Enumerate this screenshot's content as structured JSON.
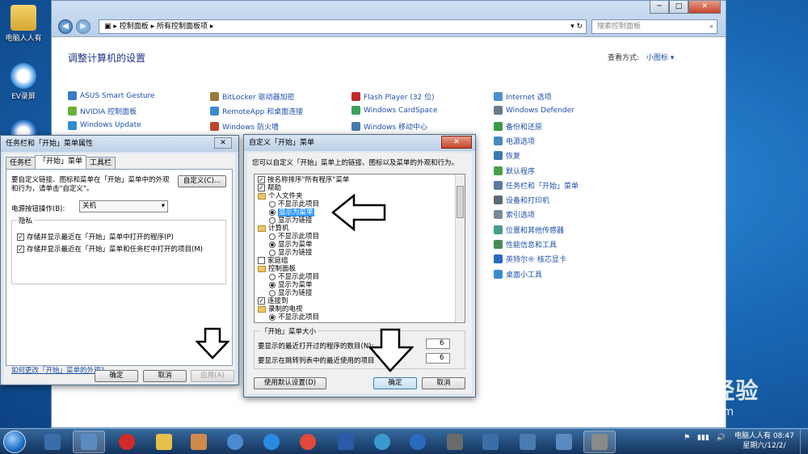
{
  "desktop": {
    "icons": [
      {
        "label": "电脑人人有",
        "icon": "user-folder-icon"
      },
      {
        "label": "EV录屏",
        "icon": "ev-recorder-icon"
      },
      {
        "label": "",
        "icon": "app-s-icon"
      }
    ]
  },
  "control_panel": {
    "breadcrumb": [
      "控制面板",
      "所有控制面板项"
    ],
    "search_placeholder": "搜索控制面板",
    "heading": "调整计算机的设置",
    "view_by_label": "查看方式:",
    "view_by_value": "小图标 ▾",
    "items": [
      {
        "label": "ASUS Smart Gesture",
        "color": "#3a78c8"
      },
      {
        "label": "NVIDIA 控制面板",
        "color": "#6bb13a"
      },
      {
        "label": "Windows Update",
        "color": "#2e8fd0"
      },
      {
        "label": "BitLocker 驱动器加密",
        "color": "#9a7a3a"
      },
      {
        "label": "RemoteApp 和桌面连接",
        "color": "#3a8ad0"
      },
      {
        "label": "Windows 防火墙",
        "color": "#c0452b"
      },
      {
        "label": "Flash Player (32 位)",
        "color": "#c02a2a"
      },
      {
        "label": "Windows CardSpace",
        "color": "#3aa05a"
      },
      {
        "label": "Windows 移动中心",
        "color": "#4a7ab0"
      },
      {
        "label": "Internet 选项",
        "color": "#4a90d0"
      },
      {
        "label": "Windows Defender",
        "color": "#6a7a8a"
      },
      {
        "label": "备份和还原",
        "color": "#3a9a4a"
      },
      {
        "label": "电源选项",
        "color": "#4a8ac0"
      },
      {
        "label": "恢复",
        "color": "#3a7ab0"
      },
      {
        "label": "默认程序",
        "color": "#4aa04a"
      },
      {
        "label": "任务栏和「开始」菜单",
        "color": "#5a7aa0"
      },
      {
        "label": "设备和打印机",
        "color": "#5a6a7a"
      },
      {
        "label": "索引选项",
        "color": "#7a8a9a"
      },
      {
        "label": "位置和其他传感器",
        "color": "#4a9a8a"
      },
      {
        "label": "性能信息和工具",
        "color": "#4a8a5a"
      },
      {
        "label": "英特尔® 核芯显卡",
        "color": "#2a6ac0"
      },
      {
        "label": "桌面小工具",
        "color": "#3a8ad0"
      }
    ]
  },
  "taskbar_props": {
    "title": "任务栏和「开始」菜单属性",
    "tabs": [
      "任务栏",
      "「开始」菜单",
      "工具栏"
    ],
    "description": "要自定义链接、图标和菜单在「开始」菜单中的外观和行为，请单击\"自定义\"。",
    "customize_button": "自定义(C)...",
    "power_button_label": "电源按钮操作(B):",
    "power_button_value": "关机",
    "privacy_label": "隐私",
    "privacy_options": [
      "存储并显示最近在「开始」菜单中打开的程序(P)",
      "存储并显示最近在「开始」菜单和任务栏中打开的项目(M)"
    ],
    "help_link": "如何更改「开始」菜单的外观?",
    "buttons": {
      "ok": "确定",
      "cancel": "取消",
      "apply": "应用(A)"
    }
  },
  "customize_dialog": {
    "title": "自定义「开始」菜单",
    "description": "您可以自定义「开始」菜单上的链接、图标以及菜单的外观和行为。",
    "tree": [
      {
        "kind": "check",
        "checked": true,
        "label": "按名称排序\"所有程序\"菜单",
        "indent": 0
      },
      {
        "kind": "check",
        "checked": true,
        "label": "帮助",
        "indent": 0
      },
      {
        "kind": "folder",
        "label": "个人文件夹",
        "indent": 0
      },
      {
        "kind": "radio",
        "on": false,
        "label": "不显示此项目",
        "indent": 1
      },
      {
        "kind": "radio",
        "on": true,
        "label": "显示为菜单",
        "indent": 1,
        "selected": true
      },
      {
        "kind": "radio",
        "on": false,
        "label": "显示为链接",
        "indent": 1
      },
      {
        "kind": "folder",
        "label": "计算机",
        "indent": 0
      },
      {
        "kind": "radio",
        "on": false,
        "label": "不显示此项目",
        "indent": 1
      },
      {
        "kind": "radio",
        "on": true,
        "label": "显示为菜单",
        "indent": 1
      },
      {
        "kind": "radio",
        "on": false,
        "label": "显示为链接",
        "indent": 1
      },
      {
        "kind": "check",
        "checked": false,
        "label": "家庭组",
        "indent": 0
      },
      {
        "kind": "folder",
        "label": "控制面板",
        "indent": 0
      },
      {
        "kind": "radio",
        "on": false,
        "label": "不显示此项目",
        "indent": 1
      },
      {
        "kind": "radio",
        "on": true,
        "label": "显示为菜单",
        "indent": 1
      },
      {
        "kind": "radio",
        "on": false,
        "label": "显示为链接",
        "indent": 1
      },
      {
        "kind": "check",
        "checked": true,
        "label": "连接到",
        "indent": 0
      },
      {
        "kind": "folder",
        "label": "录制的电视",
        "indent": 0
      },
      {
        "kind": "radio",
        "on": true,
        "label": "不显示此项目",
        "indent": 1
      }
    ],
    "size_group_label": "「开始」菜单大小",
    "recent_programs_label": "要显示的最近打开过的程序的数目(N):",
    "recent_programs_value": "6",
    "jump_list_label": "要显示在跳转列表中的最近使用的项目",
    "jump_list_value": "6",
    "defaults_button": "使用默认设置(D)",
    "buttons": {
      "ok": "确定",
      "cancel": "取消"
    }
  },
  "taskbar": {
    "apps": [
      {
        "name": "desktop-app",
        "color": "#3a6ea8"
      },
      {
        "name": "control-panel-app",
        "color": "#5a8ac0",
        "active": true
      },
      {
        "name": "chess-app",
        "color": "#d02a2a"
      },
      {
        "name": "folder-app",
        "color": "#e6c04a"
      },
      {
        "name": "paint-app",
        "color": "#d08a4a"
      },
      {
        "name": "settings-app",
        "color": "#4a8ad0"
      },
      {
        "name": "ie-app",
        "color": "#2a8ae0"
      },
      {
        "name": "chrome-app",
        "color": "#e04a3a"
      },
      {
        "name": "word-app",
        "color": "#2a5aa8"
      },
      {
        "name": "edge-app",
        "color": "#3a9ad0"
      },
      {
        "name": "s-app",
        "color": "#2a6ac0"
      },
      {
        "name": "mic-app",
        "color": "#6a6a6a"
      },
      {
        "name": "screen-app",
        "color": "#3a6ea8"
      },
      {
        "name": "window-app",
        "color": "#4a7ab0"
      },
      {
        "name": "explorer-app",
        "color": "#5a8ac0"
      },
      {
        "name": "device-app",
        "color": "#8a8a8a",
        "active": true
      }
    ],
    "user": "电脑人人有",
    "time": "08:47",
    "date": "星期六/12/2/"
  },
  "watermark": {
    "brand": "Bai du 经验",
    "url": "jingyan.baidu.com"
  }
}
